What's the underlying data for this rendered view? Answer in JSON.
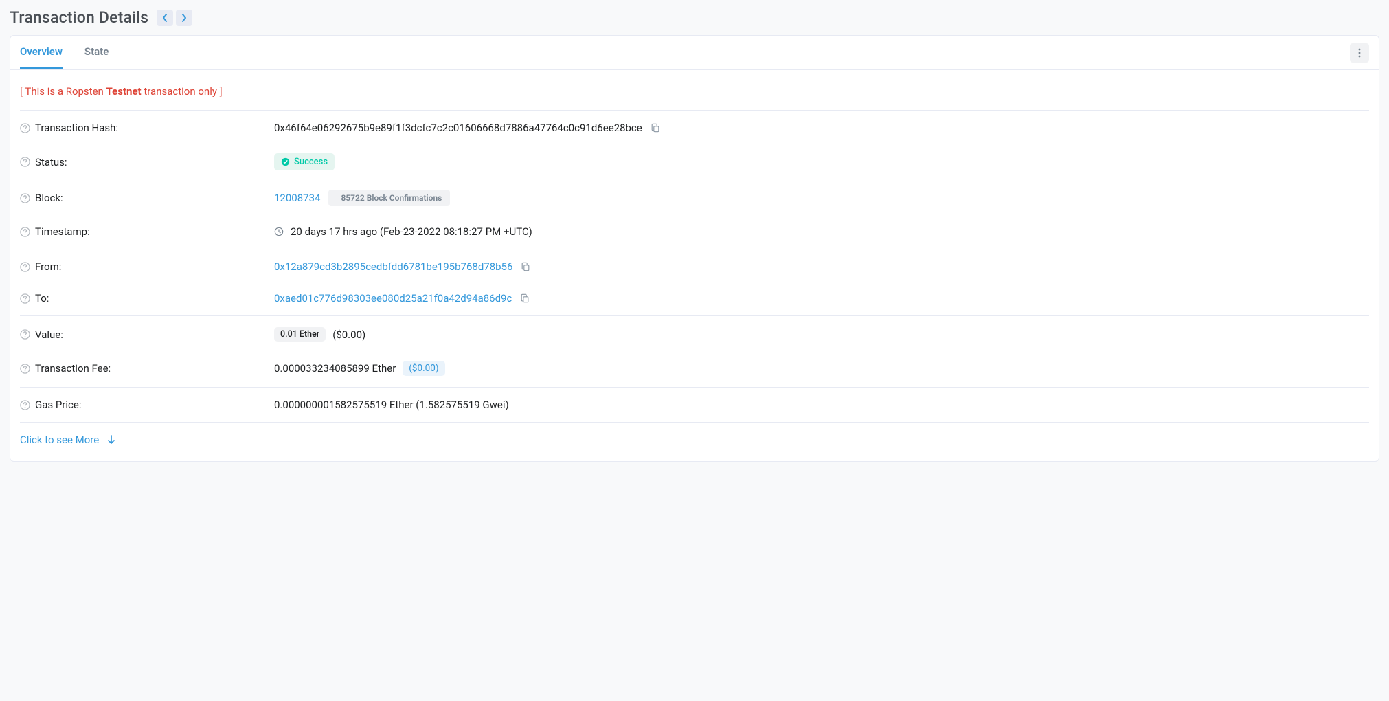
{
  "header": {
    "title": "Transaction Details"
  },
  "tabs": {
    "overview": "Overview",
    "state": "State"
  },
  "notice": {
    "pre": "[ This is a Ropsten ",
    "bold": "Testnet",
    "post": " transaction only ]"
  },
  "labels": {
    "txhash": "Transaction Hash:",
    "status": "Status:",
    "block": "Block:",
    "timestamp": "Timestamp:",
    "from": "From:",
    "to": "To:",
    "value": "Value:",
    "txfee": "Transaction Fee:",
    "gasprice": "Gas Price:"
  },
  "tx": {
    "hash": "0x46f64e06292675b9e89f1f3dcfc7c2c01606668d7886a47764c0c91d6ee28bce",
    "status": "Success",
    "block": "12008734",
    "confirmations": "85722 Block Confirmations",
    "timestamp": "20 days 17 hrs ago (Feb-23-2022 08:18:27 PM +UTC)",
    "from": "0x12a879cd3b2895cedbfdd6781be195b768d78b56",
    "to": "0xaed01c776d98303ee080d25a21f0a42d94a86d9c",
    "value_eth": "0.01 Ether",
    "value_usd": "($0.00)",
    "fee_eth": "0.000033234085899 Ether",
    "fee_usd": "($0.00)",
    "gas_price": "0.000000001582575519 Ether (1.582575519 Gwei)"
  },
  "see_more": "Click to see More"
}
